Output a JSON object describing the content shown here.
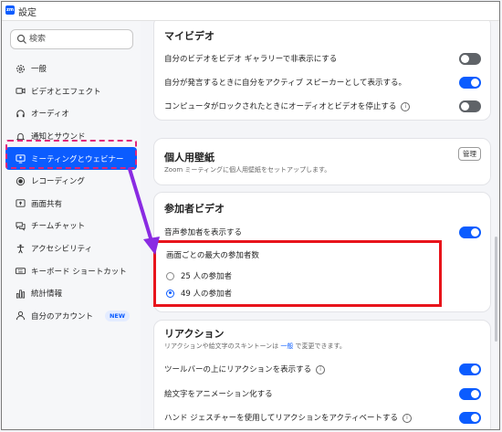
{
  "window": {
    "title": "設定",
    "app_icon": "zm"
  },
  "search": {
    "placeholder": "検索"
  },
  "sidebar": {
    "items": [
      {
        "label": "一般",
        "icon": "gear-icon"
      },
      {
        "label": "ビデオとエフェクト",
        "icon": "video-camera-icon"
      },
      {
        "label": "オーディオ",
        "icon": "headphones-icon"
      },
      {
        "label": "通知とサウンド",
        "icon": "bell-icon"
      },
      {
        "label": "ミーティングとウェビナー",
        "icon": "meeting-screen-icon",
        "active": true
      },
      {
        "label": "レコーディング",
        "icon": "record-icon"
      },
      {
        "label": "画面共有",
        "icon": "share-screen-icon"
      },
      {
        "label": "チームチャット",
        "icon": "chat-icon"
      },
      {
        "label": "アクセシビリティ",
        "icon": "accessibility-icon"
      },
      {
        "label": "キーボード ショートカット",
        "icon": "keyboard-icon"
      },
      {
        "label": "統計情報",
        "icon": "stats-icon"
      },
      {
        "label": "自分のアカウント",
        "icon": "person-icon",
        "badge": "NEW"
      }
    ]
  },
  "my_video": {
    "title": "マイビデオ",
    "rows": [
      {
        "label": "自分のビデオをビデオ ギャラリーで非表示にする",
        "on": false
      },
      {
        "label": "自分が発言するときに自分をアクティブ スピーカーとして表示する。",
        "on": true
      },
      {
        "label": "コンピュータがロックされたときにオーディオとビデオを停止する",
        "on": false,
        "info": "ⓘ"
      }
    ]
  },
  "wallpaper": {
    "title": "個人用壁紙",
    "desc": "Zoom ミーティングに個人用壁紙をセットアップします。",
    "manage_label": "管理"
  },
  "participant_video": {
    "title": "参加者ビデオ",
    "show_audio_label": "音声参加者を表示する",
    "show_audio_on": true,
    "max_label": "画面ごとの最大の参加者数",
    "options": [
      {
        "label": "25 人の参加者",
        "selected": false
      },
      {
        "label": "49 人の参加者",
        "selected": true
      }
    ]
  },
  "reactions": {
    "title": "リアクション",
    "desc_prefix": "リアクションや絵文字のスキントーンは ",
    "desc_link": "一般",
    "desc_suffix": " で変更できます。",
    "rows": [
      {
        "label": "ツールバーの上にリアクションを表示する",
        "on": true,
        "info": "ⓘ"
      },
      {
        "label": "絵文字をアニメーション化する",
        "on": true
      },
      {
        "label": "ハンド ジェスチャーを使用してリアクションをアクティベートする",
        "on": true,
        "info": "ⓘ"
      }
    ]
  },
  "colors": {
    "accent": "#0b5cff",
    "highlight_dash": "#e0257a",
    "highlight_box": "#e8141b",
    "arrow": "#8a2be2"
  }
}
